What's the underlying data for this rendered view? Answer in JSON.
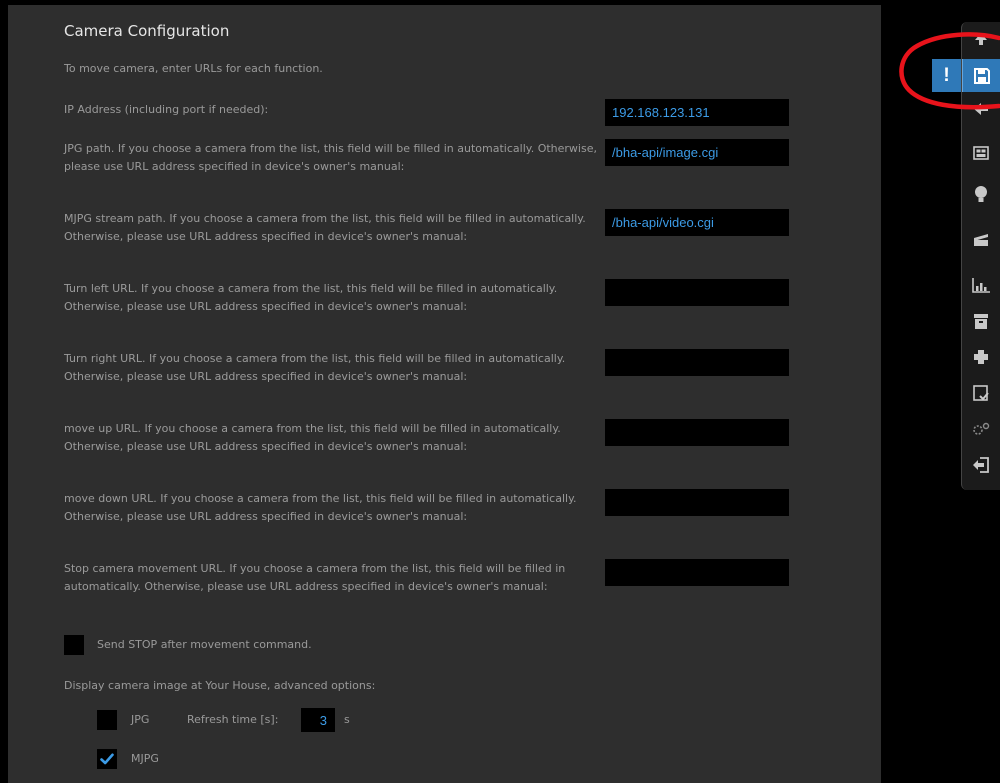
{
  "panel": {
    "title": "Camera Configuration",
    "intro": "To move camera, enter URLs for each function.",
    "fields": [
      {
        "label": "IP Address (including port if needed):",
        "value": "192.168.123.131"
      },
      {
        "label": "JPG path. If you choose a camera from the list, this field will be filled in automatically. Otherwise, please use URL address specified in device's owner's manual:",
        "value": "/bha-api/image.cgi"
      },
      {
        "label": "MJPG stream path. If you choose a camera from the list, this field will be filled in automatically. Otherwise, please use URL address specified in device's owner's manual:",
        "value": "/bha-api/video.cgi"
      },
      {
        "label": "Turn left URL. If you choose a camera from the list, this field will be filled in automatically. Otherwise, please use URL address specified in device's owner's manual:",
        "value": ""
      },
      {
        "label": "Turn right URL. If you choose a camera from the list, this field will be filled in automatically. Otherwise, please use URL address specified in device's owner's manual:",
        "value": ""
      },
      {
        "label": "move up URL. If you choose a camera from the list, this field will be filled in automatically. Otherwise, please use URL address specified in device's owner's manual:",
        "value": ""
      },
      {
        "label": "move down URL. If you choose a camera from the list, this field will be filled in automatically. Otherwise, please use URL address specified in device's owner's manual:",
        "value": ""
      },
      {
        "label": "Stop camera movement URL. If you choose a camera from the list, this field will be filled in automatically. Otherwise, please use URL address specified in device's owner's manual:",
        "value": ""
      }
    ],
    "send_stop": {
      "label": "Send STOP after movement command.",
      "checked": false
    },
    "display_heading": "Display camera image at Your House, advanced options:",
    "jpg_option": {
      "label": "JPG",
      "checked": false
    },
    "refresh": {
      "label": "Refresh time [s]:",
      "value": "3",
      "unit": "s"
    },
    "mjpg_option": {
      "label": "MJPG",
      "checked": true
    }
  },
  "toolbar": {
    "alert_symbol": "!",
    "items": [
      "up-arrow-icon",
      "save-icon",
      "back-arrow-icon",
      "image-gallery-icon",
      "bulb-icon",
      "clapperboard-icon",
      "bar-chart-icon",
      "archive-box-icon",
      "puzzle-icon",
      "calendar-check-icon",
      "gears-icon",
      "logout-icon"
    ]
  },
  "colors": {
    "panel_bg": "#2e2e2e",
    "field_text": "#3c9be6",
    "accent": "#2f79b8",
    "annotation": "#e8131b"
  }
}
